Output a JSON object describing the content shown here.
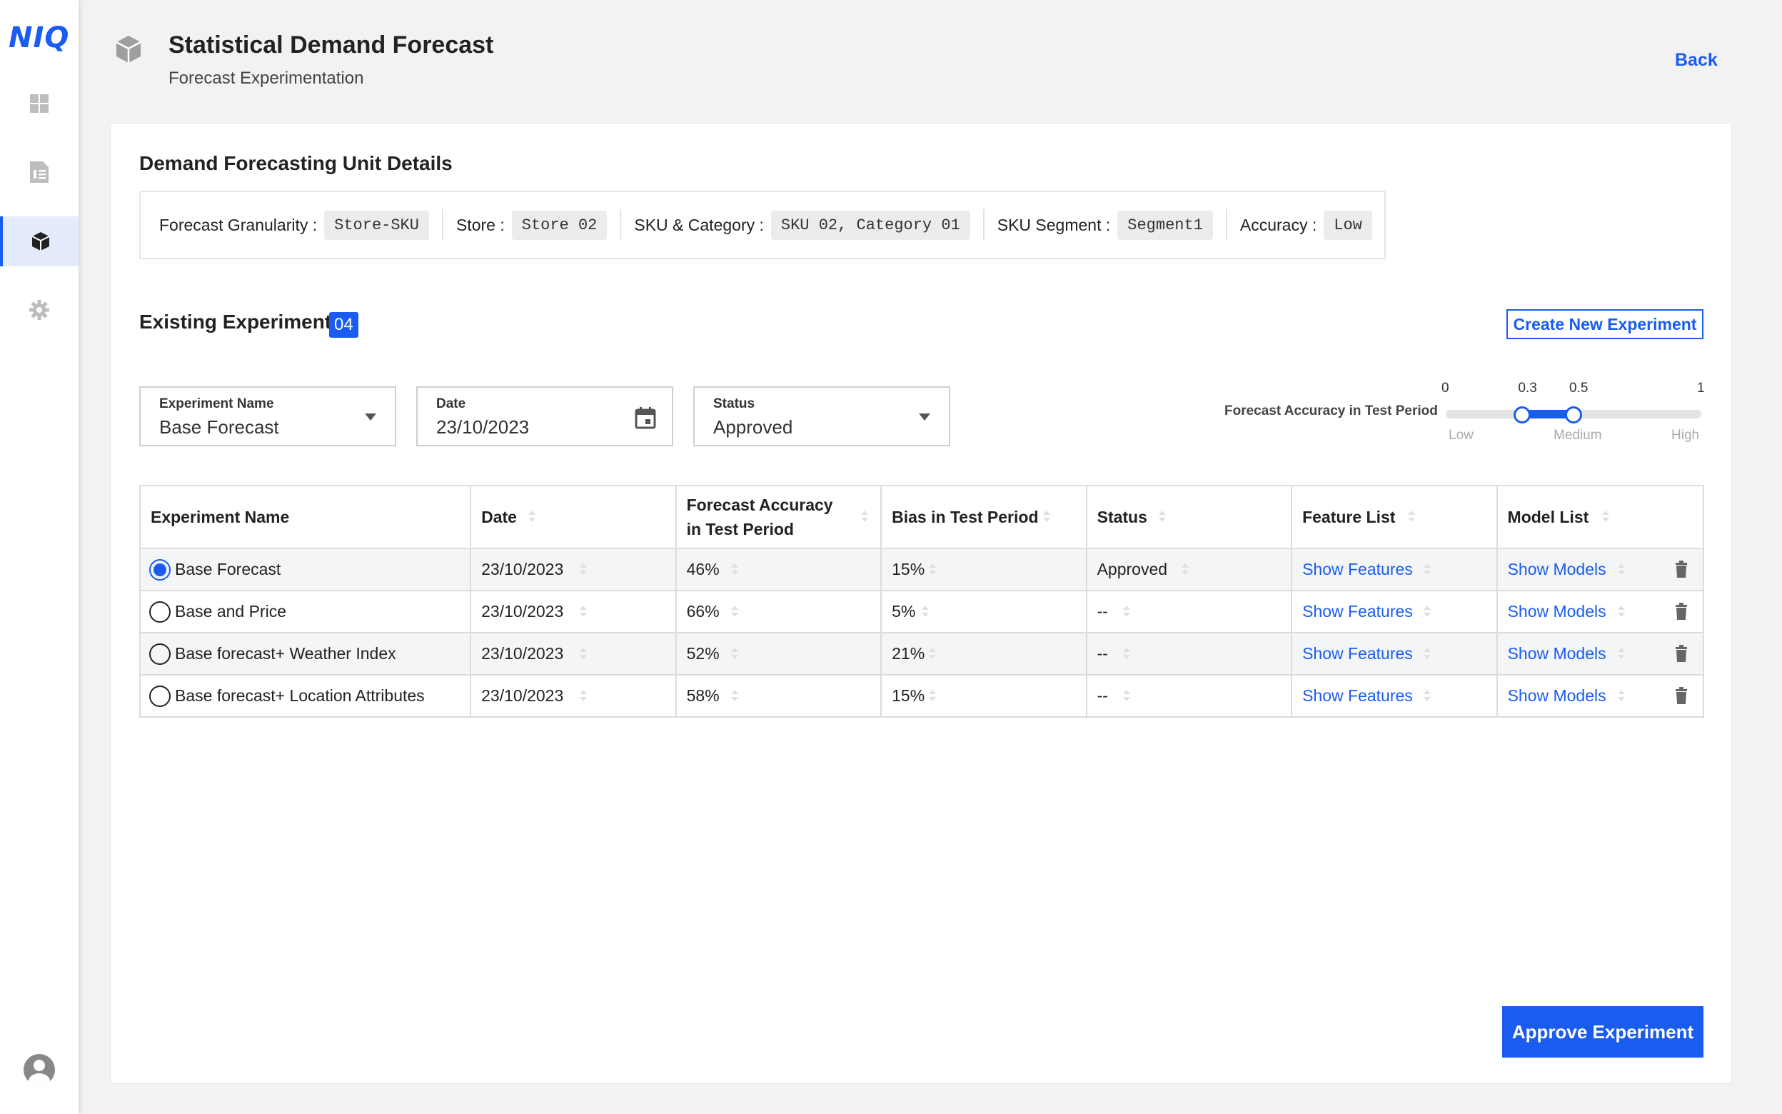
{
  "brand": {
    "logo_text": "NIQ",
    "accent": "#1a5cf0"
  },
  "sidebar": {
    "items": [
      {
        "icon": "dashboard-icon",
        "active": false
      },
      {
        "icon": "report-icon",
        "active": false
      },
      {
        "icon": "cube-icon",
        "active": true
      },
      {
        "icon": "gear-icon",
        "active": false
      }
    ],
    "profile_icon": "user-avatar-icon"
  },
  "header": {
    "title": "Statistical Demand Forecast",
    "subtitle": "Forecast Experimentation",
    "back_label": "Back"
  },
  "dfu": {
    "title": "Demand Forecasting Unit Details",
    "items": [
      {
        "label": "Forecast Granularity :",
        "value": "Store-SKU"
      },
      {
        "label": "Store :",
        "value": "Store 02"
      },
      {
        "label": "SKU & Category :",
        "value": "SKU 02, Category 01"
      },
      {
        "label": "SKU Segment :",
        "value": "Segment1"
      },
      {
        "label": "Accuracy :",
        "value": "Low"
      }
    ]
  },
  "experiments": {
    "title": "Existing Experiments",
    "count": "04",
    "create_label": "Create New Experiment",
    "filters": {
      "name": {
        "label": "Experiment Name",
        "value": "Base Forecast"
      },
      "date": {
        "label": "Date",
        "value": "23/10/2023"
      },
      "status": {
        "label": "Status",
        "value": "Approved"
      }
    },
    "slider": {
      "label": "Forecast Accuracy in Test Period",
      "ticks": [
        "0",
        "0.3",
        "0.5",
        "1"
      ],
      "range_words": [
        "Low",
        "Medium",
        "High"
      ],
      "low": 0.3,
      "high": 0.5
    },
    "columns": [
      "Experiment Name",
      "Date",
      "Forecast Accuracy in Test Period",
      "Bias in Test Period",
      "Status",
      "Feature List",
      "Model List"
    ],
    "rows": [
      {
        "name": "Base Forecast",
        "date": "23/10/2023",
        "accuracy": "46%",
        "bias": "15%",
        "status": "Approved",
        "features": "Show Features",
        "models": "Show Models",
        "selected": true
      },
      {
        "name": "Base and Price",
        "date": "23/10/2023",
        "accuracy": "66%",
        "bias": "5%",
        "status": "--",
        "features": "Show Features",
        "models": "Show Models",
        "selected": false
      },
      {
        "name": "Base forecast+ Weather Index",
        "date": "23/10/2023",
        "accuracy": "52%",
        "bias": "21%",
        "status": "--",
        "features": "Show Features",
        "models": "Show Models",
        "selected": false
      },
      {
        "name": "Base forecast+ Location Attributes",
        "date": "23/10/2023",
        "accuracy": "58%",
        "bias": "15%",
        "status": "--",
        "features": "Show Features",
        "models": "Show Models",
        "selected": false
      }
    ]
  },
  "approve_label": "Approve Experiment"
}
